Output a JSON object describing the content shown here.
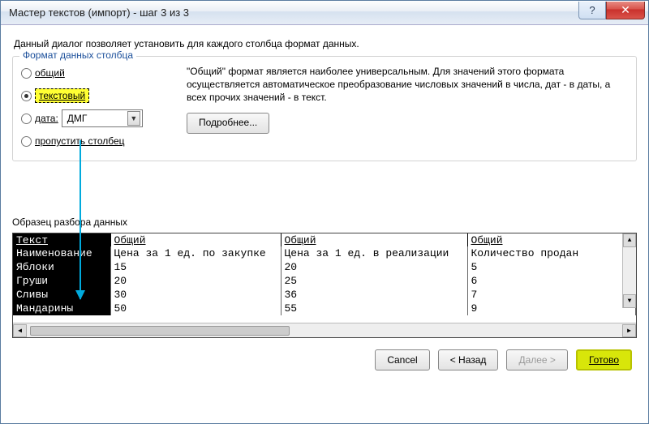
{
  "window": {
    "title": "Мастер текстов (импорт) - шаг 3 из 3"
  },
  "description": "Данный диалог позволяет установить для каждого столбца формат данных.",
  "group": {
    "legend": "Формат данных столбца",
    "radios": {
      "general": "общий",
      "text": "текстовый",
      "date_label": "дата:",
      "date_format": "ДМГ",
      "skip": "пропустить столбец"
    },
    "explanation": "\"Общий\" формат является наиболее универсальным. Для значений этого формата осуществляется автоматическое преобразование числовых значений в числа, дат - в даты, а всех прочих значений - в текст.",
    "more_btn": "Подробнее..."
  },
  "sample_label": "Образец разбора данных",
  "preview": {
    "headers": [
      "Текст",
      "Общий",
      "Общий",
      "Общий"
    ],
    "rows": [
      [
        "Наименование",
        "Цена за 1 ед. по закупке",
        "Цена за 1 ед. в реализации",
        "Количество продан"
      ],
      [
        "Яблоки",
        "15",
        "20",
        "5"
      ],
      [
        "Груши",
        "20",
        "25",
        "6"
      ],
      [
        "Сливы",
        "30",
        "36",
        "7"
      ],
      [
        "Мандарины",
        "50",
        "55",
        "9"
      ]
    ]
  },
  "footer": {
    "cancel": "Cancel",
    "back": "< Назад",
    "next": "Далее >",
    "finish": "Готово"
  }
}
